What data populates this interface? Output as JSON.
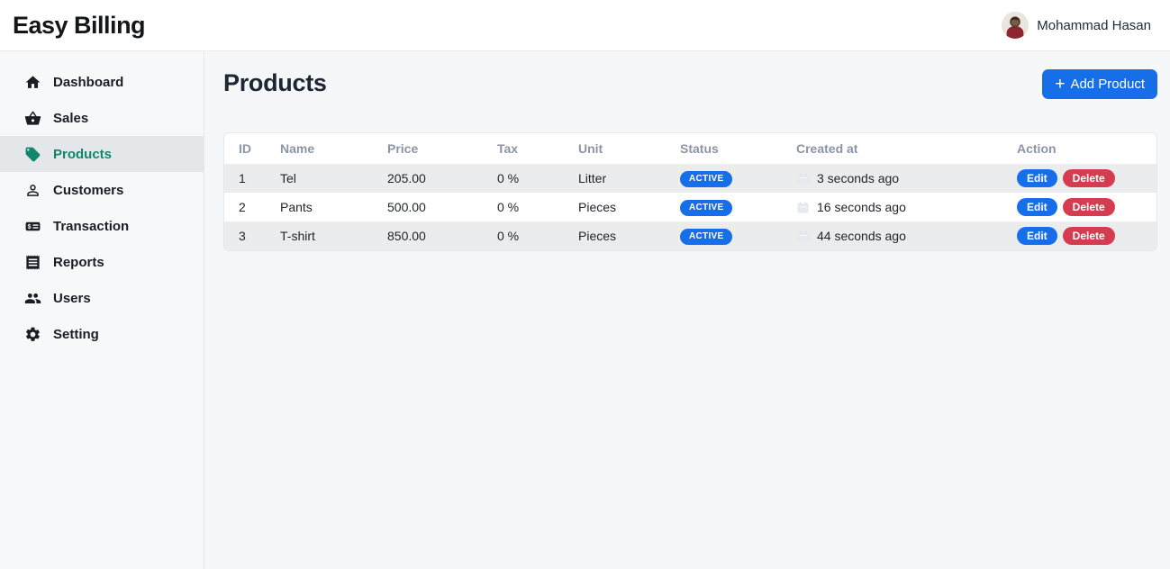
{
  "header": {
    "logo": "Easy Billing",
    "user_name": "Mohammad Hasan"
  },
  "sidebar": {
    "items": [
      {
        "label": "Dashboard",
        "icon": "home-icon",
        "active": false
      },
      {
        "label": "Sales",
        "icon": "basket-icon",
        "active": false
      },
      {
        "label": "Products",
        "icon": "tag-icon",
        "active": true
      },
      {
        "label": "Customers",
        "icon": "person-icon",
        "active": false
      },
      {
        "label": "Transaction",
        "icon": "credit-card-icon",
        "active": false
      },
      {
        "label": "Reports",
        "icon": "receipt-icon",
        "active": false
      },
      {
        "label": "Users",
        "icon": "users-icon",
        "active": false
      },
      {
        "label": "Setting",
        "icon": "gear-icon",
        "active": false
      }
    ]
  },
  "main": {
    "title": "Products",
    "add_button": {
      "plus": "+",
      "label": "Add Product"
    }
  },
  "table": {
    "columns": [
      "ID",
      "Name",
      "Price",
      "Tax",
      "Unit",
      "Status",
      "Created at",
      "Action"
    ],
    "rows": [
      {
        "id": "1",
        "name": "Tel",
        "price": "205.00",
        "tax": "0 %",
        "unit": "Litter",
        "status": "ACTIVE",
        "created_at": "3 seconds ago"
      },
      {
        "id": "2",
        "name": "Pants",
        "price": "500.00",
        "tax": "0 %",
        "unit": "Pieces",
        "status": "ACTIVE",
        "created_at": "16 seconds ago"
      },
      {
        "id": "3",
        "name": "T-shirt",
        "price": "850.00",
        "tax": "0 %",
        "unit": "Pieces",
        "status": "ACTIVE",
        "created_at": "44 seconds ago"
      }
    ],
    "actions": {
      "edit": "Edit",
      "delete": "Delete"
    }
  },
  "colors": {
    "primary_blue": "#166ee8",
    "danger_red": "#d63c4f",
    "active_green": "#11866b",
    "stripe_gray": "#ebecee"
  }
}
